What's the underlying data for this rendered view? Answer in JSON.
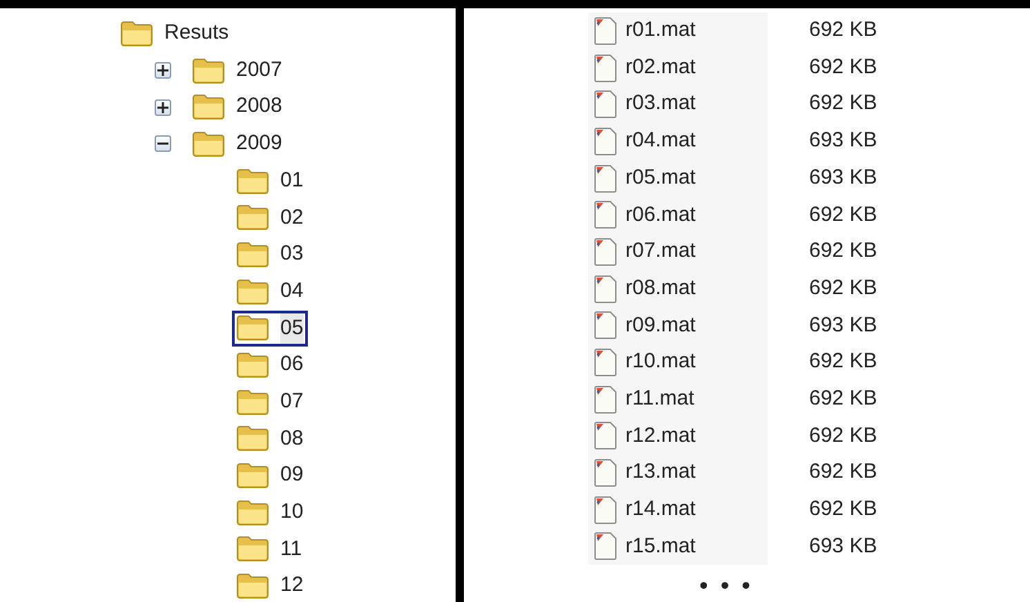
{
  "tree": {
    "label": "Resuts",
    "selected": false,
    "children": [
      {
        "label": "2007",
        "expanded": false,
        "selected": false
      },
      {
        "label": "2008",
        "expanded": false,
        "selected": false
      },
      {
        "label": "2009",
        "expanded": true,
        "selected": false,
        "children": [
          {
            "label": "01",
            "selected": false
          },
          {
            "label": "02",
            "selected": false
          },
          {
            "label": "03",
            "selected": false
          },
          {
            "label": "04",
            "selected": false
          },
          {
            "label": "05",
            "selected": true
          },
          {
            "label": "06",
            "selected": false
          },
          {
            "label": "07",
            "selected": false
          },
          {
            "label": "08",
            "selected": false
          },
          {
            "label": "09",
            "selected": false
          },
          {
            "label": "10",
            "selected": false
          },
          {
            "label": "11",
            "selected": false
          },
          {
            "label": "12",
            "selected": false
          }
        ]
      }
    ]
  },
  "files": [
    {
      "name": "r01.mat",
      "size": "692 KB"
    },
    {
      "name": "r02.mat",
      "size": "692 KB"
    },
    {
      "name": "r03.mat",
      "size": "692 KB"
    },
    {
      "name": "r04.mat",
      "size": "693 KB"
    },
    {
      "name": "r05.mat",
      "size": "693 KB"
    },
    {
      "name": "r06.mat",
      "size": "692 KB"
    },
    {
      "name": "r07.mat",
      "size": "692 KB"
    },
    {
      "name": "r08.mat",
      "size": "692 KB"
    },
    {
      "name": "r09.mat",
      "size": "693 KB"
    },
    {
      "name": "r10.mat",
      "size": "692 KB"
    },
    {
      "name": "r11.mat",
      "size": "692 KB"
    },
    {
      "name": "r12.mat",
      "size": "692 KB"
    },
    {
      "name": "r13.mat",
      "size": "692 KB"
    },
    {
      "name": "r14.mat",
      "size": "692 KB"
    },
    {
      "name": "r15.mat",
      "size": "693 KB"
    }
  ],
  "ellipsis": "• • •"
}
